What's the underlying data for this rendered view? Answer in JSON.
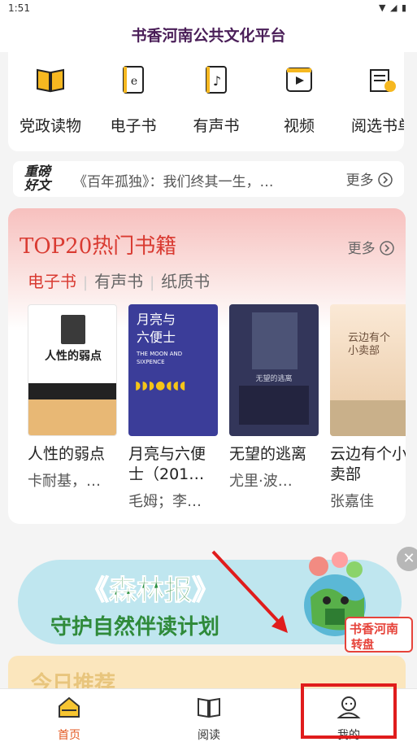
{
  "status_bar": {
    "time": "1:51"
  },
  "header": {
    "title": "书香河南公共文化平台"
  },
  "categories": [
    {
      "label": "党政读物",
      "icon": "open-book-icon"
    },
    {
      "label": "电子书",
      "icon": "ebook-icon"
    },
    {
      "label": "有声书",
      "icon": "audiobook-icon"
    },
    {
      "label": "视频",
      "icon": "video-icon"
    },
    {
      "label": "阅选书单",
      "icon": "book-list-icon"
    }
  ],
  "news": {
    "logo": "重磅好文",
    "text": "《百年孤独》：我们终其一生，…",
    "more": "更多"
  },
  "top20": {
    "title": "TOP20热门书籍",
    "more": "更多",
    "tabs": [
      "电子书",
      "有声书",
      "纸质书"
    ],
    "active_tab": "电子书",
    "books": [
      {
        "title": "人性的弱点",
        "author": "卡耐基，…",
        "cover_title": "人性的弱点",
        "cover_color": "#ffffff"
      },
      {
        "title": "月亮与六便士（201…",
        "author": "毛姆；李…",
        "cover_title": "月亮与六便士",
        "cover_subtitle": "THE MOON AND SIXPENCE",
        "cover_color": "#3b3d99"
      },
      {
        "title": "无望的逃离",
        "author": "尤里·波…",
        "cover_title": "无望的逃离",
        "cover_color": "#33365a"
      },
      {
        "title": "云边有个小卖部",
        "author": "张嘉佳",
        "cover_title": "云边有个小卖部",
        "cover_color": "#f6dcc2"
      }
    ]
  },
  "banner": {
    "title": "《森林报》",
    "subtitle": "守护自然伴读计划",
    "badge_line1": "书香河南",
    "badge_line2": "转盘"
  },
  "today": {
    "title": "今日推荐"
  },
  "bottom_nav": [
    {
      "label": "首页",
      "icon": "home-icon",
      "active": true
    },
    {
      "label": "阅读",
      "icon": "read-book-icon",
      "active": false
    },
    {
      "label": "我的",
      "icon": "profile-icon",
      "active": false
    }
  ],
  "colors": {
    "accent": "#d93a31",
    "title": "#4a1e58",
    "nav_active": "#e35a23",
    "highlight": "#e01c1c"
  }
}
